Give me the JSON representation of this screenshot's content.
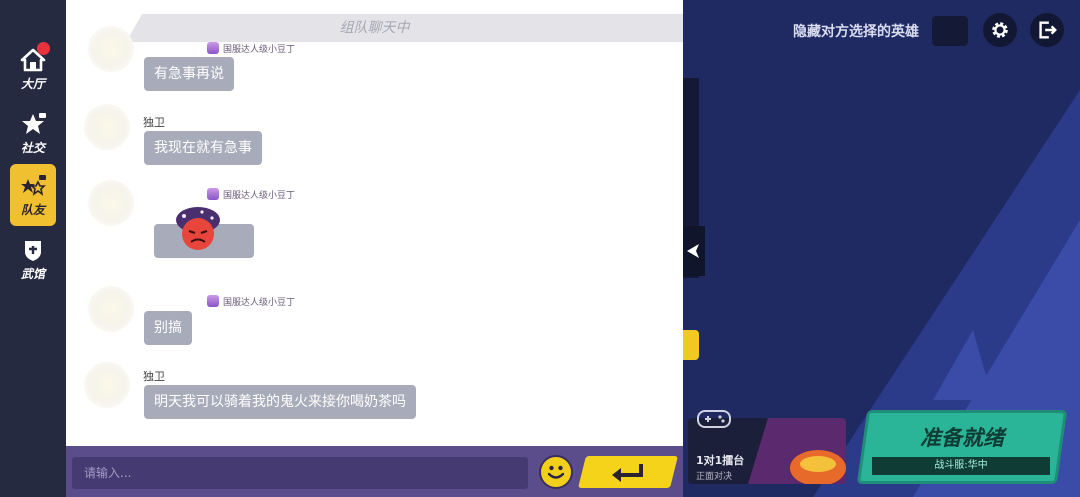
{
  "nav": {
    "items": [
      {
        "label": "大厅",
        "icon": "home-icon",
        "badge": true
      },
      {
        "label": "社交",
        "icon": "social-icon"
      },
      {
        "label": "队友",
        "icon": "teammates-icon",
        "active": true
      },
      {
        "label": "武馆",
        "icon": "dojo-icon"
      }
    ]
  },
  "chat": {
    "header_title": "组队聊天中",
    "messages": [
      {
        "username": "",
        "title_tag": "国服达人级小豆丁",
        "text": "有急事再说"
      },
      {
        "username": "独卫",
        "title_tag": "",
        "text": "我现在就有急事"
      },
      {
        "username": "",
        "title_tag": "国服达人级小豆丁",
        "text": "",
        "sticker": "angry-face-sticker"
      },
      {
        "username": "",
        "title_tag": "国服达人级小豆丁",
        "text": "别搞"
      },
      {
        "username": "独卫",
        "title_tag": "",
        "text": "明天我可以骑着我的鬼火来接你喝奶茶吗"
      }
    ],
    "input_placeholder": "请输入..."
  },
  "right": {
    "hide_hero_label": "隐藏对方选择的英雄",
    "mode": {
      "title": "1对1擂台",
      "subtitle": "正面对决"
    },
    "ready": {
      "title": "准备就绪",
      "subtitle": "战斗服:华中"
    }
  },
  "colors": {
    "active_nav": "#f0c030",
    "bubble": "#a8abb9",
    "input_bar": "#5b4c8c",
    "send_button": "#f4d31a",
    "ready_button": "#2bb598",
    "badge": "#e8323c"
  }
}
